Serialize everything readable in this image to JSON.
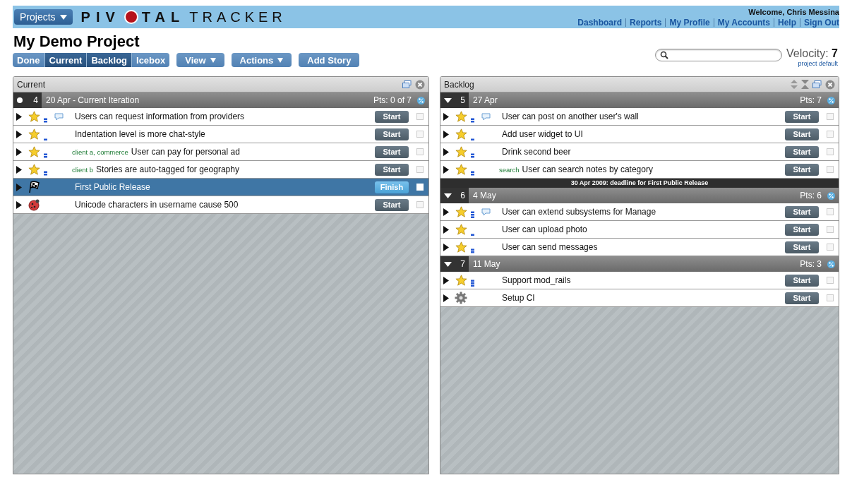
{
  "header": {
    "projects_button": "Projects",
    "logo": [
      "PIV",
      "TAL",
      "TRACKER"
    ],
    "welcome": "Welcome, Chris Messina",
    "links": [
      "Dashboard",
      "Reports",
      "My Profile",
      "My Accounts",
      "Help",
      "Sign Out"
    ]
  },
  "project_title": "My Demo Project",
  "toolbar": {
    "tabs": [
      {
        "label": "Done",
        "selected": false
      },
      {
        "label": "Current",
        "selected": true
      },
      {
        "label": "Backlog",
        "selected": true
      },
      {
        "label": "Icebox",
        "selected": false
      }
    ],
    "menus": [
      {
        "label": "View",
        "kind": "dropdown"
      },
      {
        "label": "Actions",
        "kind": "dropdown"
      },
      {
        "label": "Add Story",
        "kind": "button"
      }
    ],
    "velocity_label": "Velocity:",
    "velocity": "7",
    "velocity_note": "project default"
  },
  "panels": [
    {
      "title": "Current",
      "kind": "current",
      "iterations": [
        {
          "kind": "current",
          "number": "4",
          "date": "20 Apr - Current Iteration",
          "points": "Pts: 0 of 7",
          "stories": [
            {
              "kind": "feature",
              "estimate": {
                "kind": "medium"
              },
              "comment": true,
              "title": "Users can request information from providers",
              "button": "Start",
              "selected": false,
              "checked": false
            },
            {
              "kind": "feature",
              "estimate": {
                "kind": "small"
              },
              "comment": false,
              "title": "Indentation level is more chat-style",
              "button": "Start",
              "selected": false,
              "checked": false
            },
            {
              "kind": "feature",
              "estimate": {
                "kind": "medium"
              },
              "comment": false,
              "labels": "client a, commerce",
              "title": "User can pay for personal ad",
              "button": "Start",
              "selected": false,
              "checked": false
            },
            {
              "kind": "feature",
              "estimate": {
                "kind": "medium"
              },
              "comment": false,
              "labels": "client b",
              "title": "Stories are auto-tagged for geography",
              "button": "Start",
              "selected": false,
              "checked": false
            },
            {
              "kind": "release",
              "comment": false,
              "title": "First Public Release",
              "button": "Finish",
              "selected": true,
              "checked": false
            },
            {
              "kind": "bug",
              "comment": false,
              "title": "Unicode characters in username cause 500",
              "button": "Start",
              "selected": false,
              "checked": false
            }
          ]
        }
      ]
    },
    {
      "title": "Backlog",
      "kind": "backlog",
      "iterations": [
        {
          "kind": "future",
          "number": "5",
          "date": "27 Apr",
          "points": "Pts: 7",
          "marker": "30 Apr 2009: deadline for First Public Release",
          "stories": [
            {
              "kind": "feature",
              "estimate": {
                "kind": "medium"
              },
              "comment": true,
              "title": "User can post on another user's wall",
              "button": "Start",
              "selected": false,
              "checked": false
            },
            {
              "kind": "feature",
              "estimate": {
                "kind": "small"
              },
              "comment": false,
              "title": "Add user widget to UI",
              "button": "Start",
              "selected": false,
              "checked": false
            },
            {
              "kind": "feature",
              "estimate": {
                "kind": "medium"
              },
              "comment": false,
              "title": "Drink second beer",
              "button": "Start",
              "selected": false,
              "checked": false
            },
            {
              "kind": "feature",
              "estimate": {
                "kind": "medium"
              },
              "comment": false,
              "labels": "search",
              "title": "User can search notes by category",
              "button": "Start",
              "selected": false,
              "checked": false
            }
          ]
        },
        {
          "kind": "future",
          "number": "6",
          "date": "4 May",
          "points": "Pts: 6",
          "stories": [
            {
              "kind": "feature",
              "estimate": {
                "kind": "large"
              },
              "comment": true,
              "title": "User can extend subsystems for Manage",
              "button": "Start",
              "selected": false,
              "checked": false
            },
            {
              "kind": "feature",
              "estimate": {
                "kind": "small"
              },
              "comment": false,
              "title": "User can upload photo",
              "button": "Start",
              "selected": false,
              "checked": false
            },
            {
              "kind": "feature",
              "estimate": {
                "kind": "medium"
              },
              "comment": false,
              "title": "User can send messages",
              "button": "Start",
              "selected": false,
              "checked": false
            }
          ]
        },
        {
          "kind": "future",
          "number": "7",
          "date": "11 May",
          "points": "Pts: 3",
          "stories": [
            {
              "kind": "feature",
              "estimate": {
                "kind": "large"
              },
              "comment": false,
              "title": "Support mod_rails",
              "button": "Start",
              "selected": false,
              "checked": false
            },
            {
              "kind": "chore",
              "comment": false,
              "title": "Setup CI",
              "button": "Start",
              "selected": false,
              "checked": false
            }
          ]
        }
      ]
    }
  ]
}
